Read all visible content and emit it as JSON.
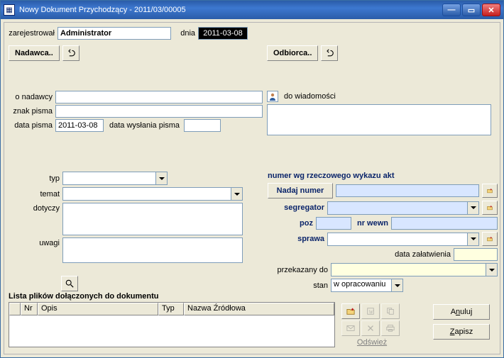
{
  "window": {
    "title": "Nowy Dokument Przychodzący - 2011/03/00005"
  },
  "header": {
    "registered_by_label": "zarejestrował",
    "registered_by_value": "Administrator",
    "date_label": "dnia",
    "date_value": "2011-03-08"
  },
  "sender": {
    "group_button": "Nadawca..",
    "about_label": "o nadawcy",
    "about_value": "",
    "sign_label": "znak pisma",
    "sign_value": "",
    "letter_date_label": "data pisma",
    "letter_date_value": "2011-03-08",
    "sent_date_label": "data wysłania pisma",
    "sent_date_value": ""
  },
  "recipient": {
    "group_button": "Odbiorca..",
    "cc_label": "do  wiadomości",
    "cc_value": ""
  },
  "left_mid": {
    "type_label": "typ",
    "type_value": "",
    "subject_label": "temat",
    "subject_value": "",
    "concerns_label": "dotyczy",
    "concerns_value": "",
    "remarks_label": "uwagi",
    "remarks_value": ""
  },
  "right_mid": {
    "section_title": "numer wg rzeczowego wykazu akt",
    "assign_number_button": "Nadaj numer",
    "number_value": "",
    "binder_label": "segregator",
    "binder_value": "",
    "pos_label": "poz",
    "pos_value": "",
    "internal_no_label": "nr wewn",
    "internal_no_value": "",
    "case_label": "sprawa",
    "case_value": "",
    "settle_date_label": "data załatwienia",
    "settle_date_value": "",
    "forwarded_label": "przekazany  do",
    "forwarded_value": "",
    "state_label": "stan",
    "state_value": "w opracowaniu"
  },
  "files": {
    "title": "Lista plików dołączonych do dokumentu",
    "columns": {
      "nr": "Nr",
      "desc": "Opis",
      "type": "Typ",
      "source": "Nazwa Źródłowa"
    },
    "refresh_label": "Odśwież"
  },
  "actions": {
    "cancel_pre": "A",
    "cancel_key": "n",
    "cancel_post": "uluj",
    "save_pre": "",
    "save_key": "Z",
    "save_post": "apisz"
  }
}
